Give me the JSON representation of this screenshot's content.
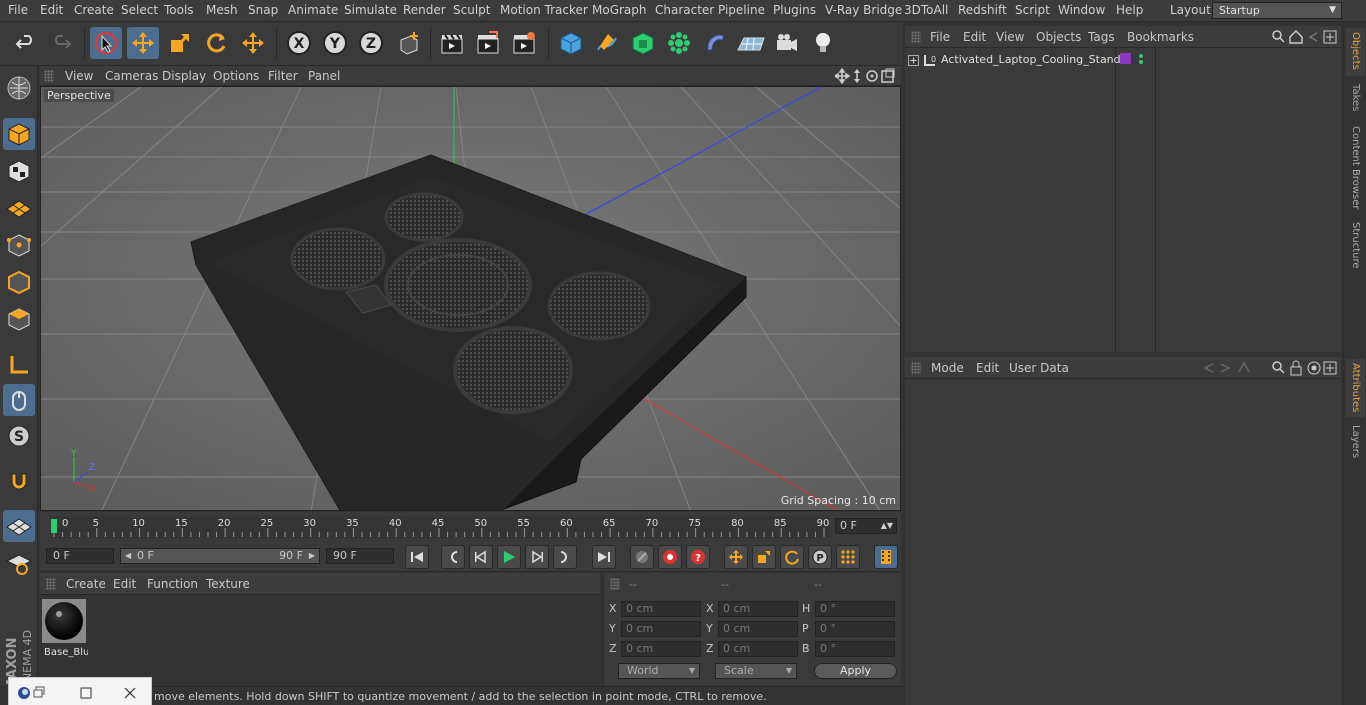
{
  "menu": {
    "items": [
      "File",
      "Edit",
      "Create",
      "Select",
      "Tools",
      "Mesh",
      "Snap",
      "Animate",
      "Simulate",
      "Render",
      "Sculpt",
      "Motion Tracker",
      "MoGraph",
      "Character",
      "Pipeline",
      "Plugins",
      "V-Ray Bridge",
      "3DToAll",
      "Redshift",
      "Script",
      "Window",
      "Help"
    ],
    "layout_label": "Layout:",
    "layout_value": "Startup"
  },
  "viewport": {
    "menu": [
      "View",
      "Cameras",
      "Display",
      "Options",
      "Filter",
      "Panel"
    ],
    "label": "Perspective",
    "grid_spacing": "Grid Spacing : 10 cm"
  },
  "timeline": {
    "ticks": [
      "0",
      "5",
      "10",
      "15",
      "20",
      "25",
      "30",
      "35",
      "40",
      "45",
      "50",
      "55",
      "60",
      "65",
      "70",
      "75",
      "80",
      "85",
      "90"
    ],
    "current_frame": "0 F"
  },
  "transport": {
    "start_frame": "0 F",
    "range_start": "0 F",
    "range_end": "90 F",
    "end_frame": "90 F"
  },
  "materials": {
    "menu": [
      "Create",
      "Edit",
      "Function",
      "Texture"
    ],
    "items": [
      {
        "name": "Base_Blu"
      }
    ]
  },
  "coords": {
    "headers": [
      "--",
      "--",
      "--"
    ],
    "rows": [
      {
        "a": "X",
        "av": "0 cm",
        "b": "X",
        "bv": "0 cm",
        "c": "H",
        "cv": "0 °"
      },
      {
        "a": "Y",
        "av": "0 cm",
        "b": "Y",
        "bv": "0 cm",
        "c": "P",
        "cv": "0 °"
      },
      {
        "a": "Z",
        "av": "0 cm",
        "b": "Z",
        "bv": "0 cm",
        "c": "B",
        "cv": "0 °"
      }
    ],
    "world": "World",
    "scale": "Scale",
    "apply": "Apply"
  },
  "status": {
    "text": "move elements. Hold down SHIFT to quantize movement / add to the selection in point mode, CTRL to remove."
  },
  "objects": {
    "menu": [
      "File",
      "Edit",
      "View",
      "Objects",
      "Tags",
      "Bookmarks"
    ],
    "items": [
      {
        "name": "Activated_Laptop_Cooling_Stand"
      }
    ]
  },
  "attributes": {
    "menu": [
      "Mode",
      "Edit",
      "User Data"
    ]
  },
  "sidetabs": [
    "Objects",
    "Takes",
    "Content Browser",
    "Structure",
    "Attributes",
    "Layers"
  ],
  "brand": {
    "vendor": "MAXON",
    "product": "CINEMA 4D"
  },
  "colors": {
    "accent": "#4d6d8f",
    "tab_active": "#e8a13a",
    "playhead": "#2ecc71"
  }
}
